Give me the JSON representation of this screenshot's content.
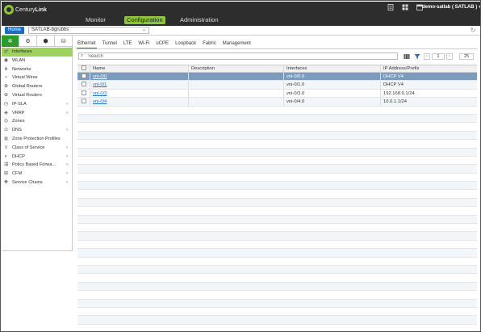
{
  "brand": {
    "name": "CenturyLink",
    "part1": "Century",
    "part2": "Link"
  },
  "nav": {
    "items": [
      "Monitor",
      "Configuration",
      "Administration"
    ],
    "active": "Configuration"
  },
  "header": {
    "user": "demo-satlab ( SATLAB )",
    "icons": [
      "document-icon",
      "grid-icon",
      "calendar-icon"
    ]
  },
  "subbar": {
    "home_label": "Home",
    "org_selected": "SATLAB-bgrubbs"
  },
  "sidebar": {
    "tab_icons": [
      "network-icon",
      "gear-icon",
      "shield-icon",
      "database-icon"
    ],
    "items": [
      {
        "label": "Interfaces",
        "icon": "interfaces-icon",
        "active": true,
        "expandable": false
      },
      {
        "label": "WLAN",
        "icon": "wifi-icon",
        "active": false,
        "expandable": false
      },
      {
        "label": "Networks",
        "icon": "networks-icon",
        "active": false,
        "expandable": false
      },
      {
        "label": "Virtual Wires",
        "icon": "wire-icon",
        "active": false,
        "expandable": false
      },
      {
        "label": "Global Routers",
        "icon": "router-icon",
        "active": false,
        "expandable": false
      },
      {
        "label": "Virtual Routers",
        "icon": "router-icon",
        "active": false,
        "expandable": false
      },
      {
        "label": "IP-SLA",
        "icon": "sla-icon",
        "active": false,
        "expandable": true
      },
      {
        "label": "VRRP",
        "icon": "vrrp-icon",
        "active": false,
        "expandable": true
      },
      {
        "label": "Zones",
        "icon": "zones-icon",
        "active": false,
        "expandable": false
      },
      {
        "label": "DNS",
        "icon": "dns-icon",
        "active": false,
        "expandable": true
      },
      {
        "label": "Zone Protection Profiles",
        "icon": "protection-icon",
        "active": false,
        "expandable": false
      },
      {
        "label": "Class of Service",
        "icon": "cos-icon",
        "active": false,
        "expandable": true
      },
      {
        "label": "DHCP",
        "icon": "dhcp-icon",
        "active": false,
        "expandable": true
      },
      {
        "label": "Policy Based Forwa...",
        "icon": "policy-icon",
        "active": false,
        "expandable": true
      },
      {
        "label": "CFM",
        "icon": "cfm-icon",
        "active": false,
        "expandable": true
      },
      {
        "label": "Service Chains",
        "icon": "chain-icon",
        "active": false,
        "expandable": true
      }
    ]
  },
  "tabs": [
    "Ethernet",
    "Tunnel",
    "LTE",
    "Wi-Fi",
    "uCPE",
    "Loopback",
    "Fabric",
    "Management"
  ],
  "active_tab": "Ethernet",
  "search": {
    "placeholder": "Search"
  },
  "pagination": {
    "page": "1",
    "page_size": "25"
  },
  "table": {
    "columns": [
      "Name",
      "Description",
      "Interfaces",
      "IP Address/Prefix"
    ],
    "rows": [
      {
        "name": "vni-0/0",
        "description": "",
        "interfaces": "vni-0/0.0",
        "ip": "DHCP V4",
        "selected": true
      },
      {
        "name": "vni-0/1",
        "description": "",
        "interfaces": "vni-0/1.0",
        "ip": "DHCP V4",
        "selected": false
      },
      {
        "name": "vni-0/3",
        "description": "",
        "interfaces": "vni-0/3.0",
        "ip": "192.168.0.1/24",
        "selected": false
      },
      {
        "name": "vni-0/4",
        "description": "",
        "interfaces": "vni-0/4.0",
        "ip": "10.0.1.1/24",
        "selected": false
      }
    ]
  },
  "colors": {
    "accent_green": "#8cc63f",
    "brand_blue": "#1a6fc4",
    "selected_row": "#7b9cbf",
    "topbar": "#2d2d2d"
  }
}
